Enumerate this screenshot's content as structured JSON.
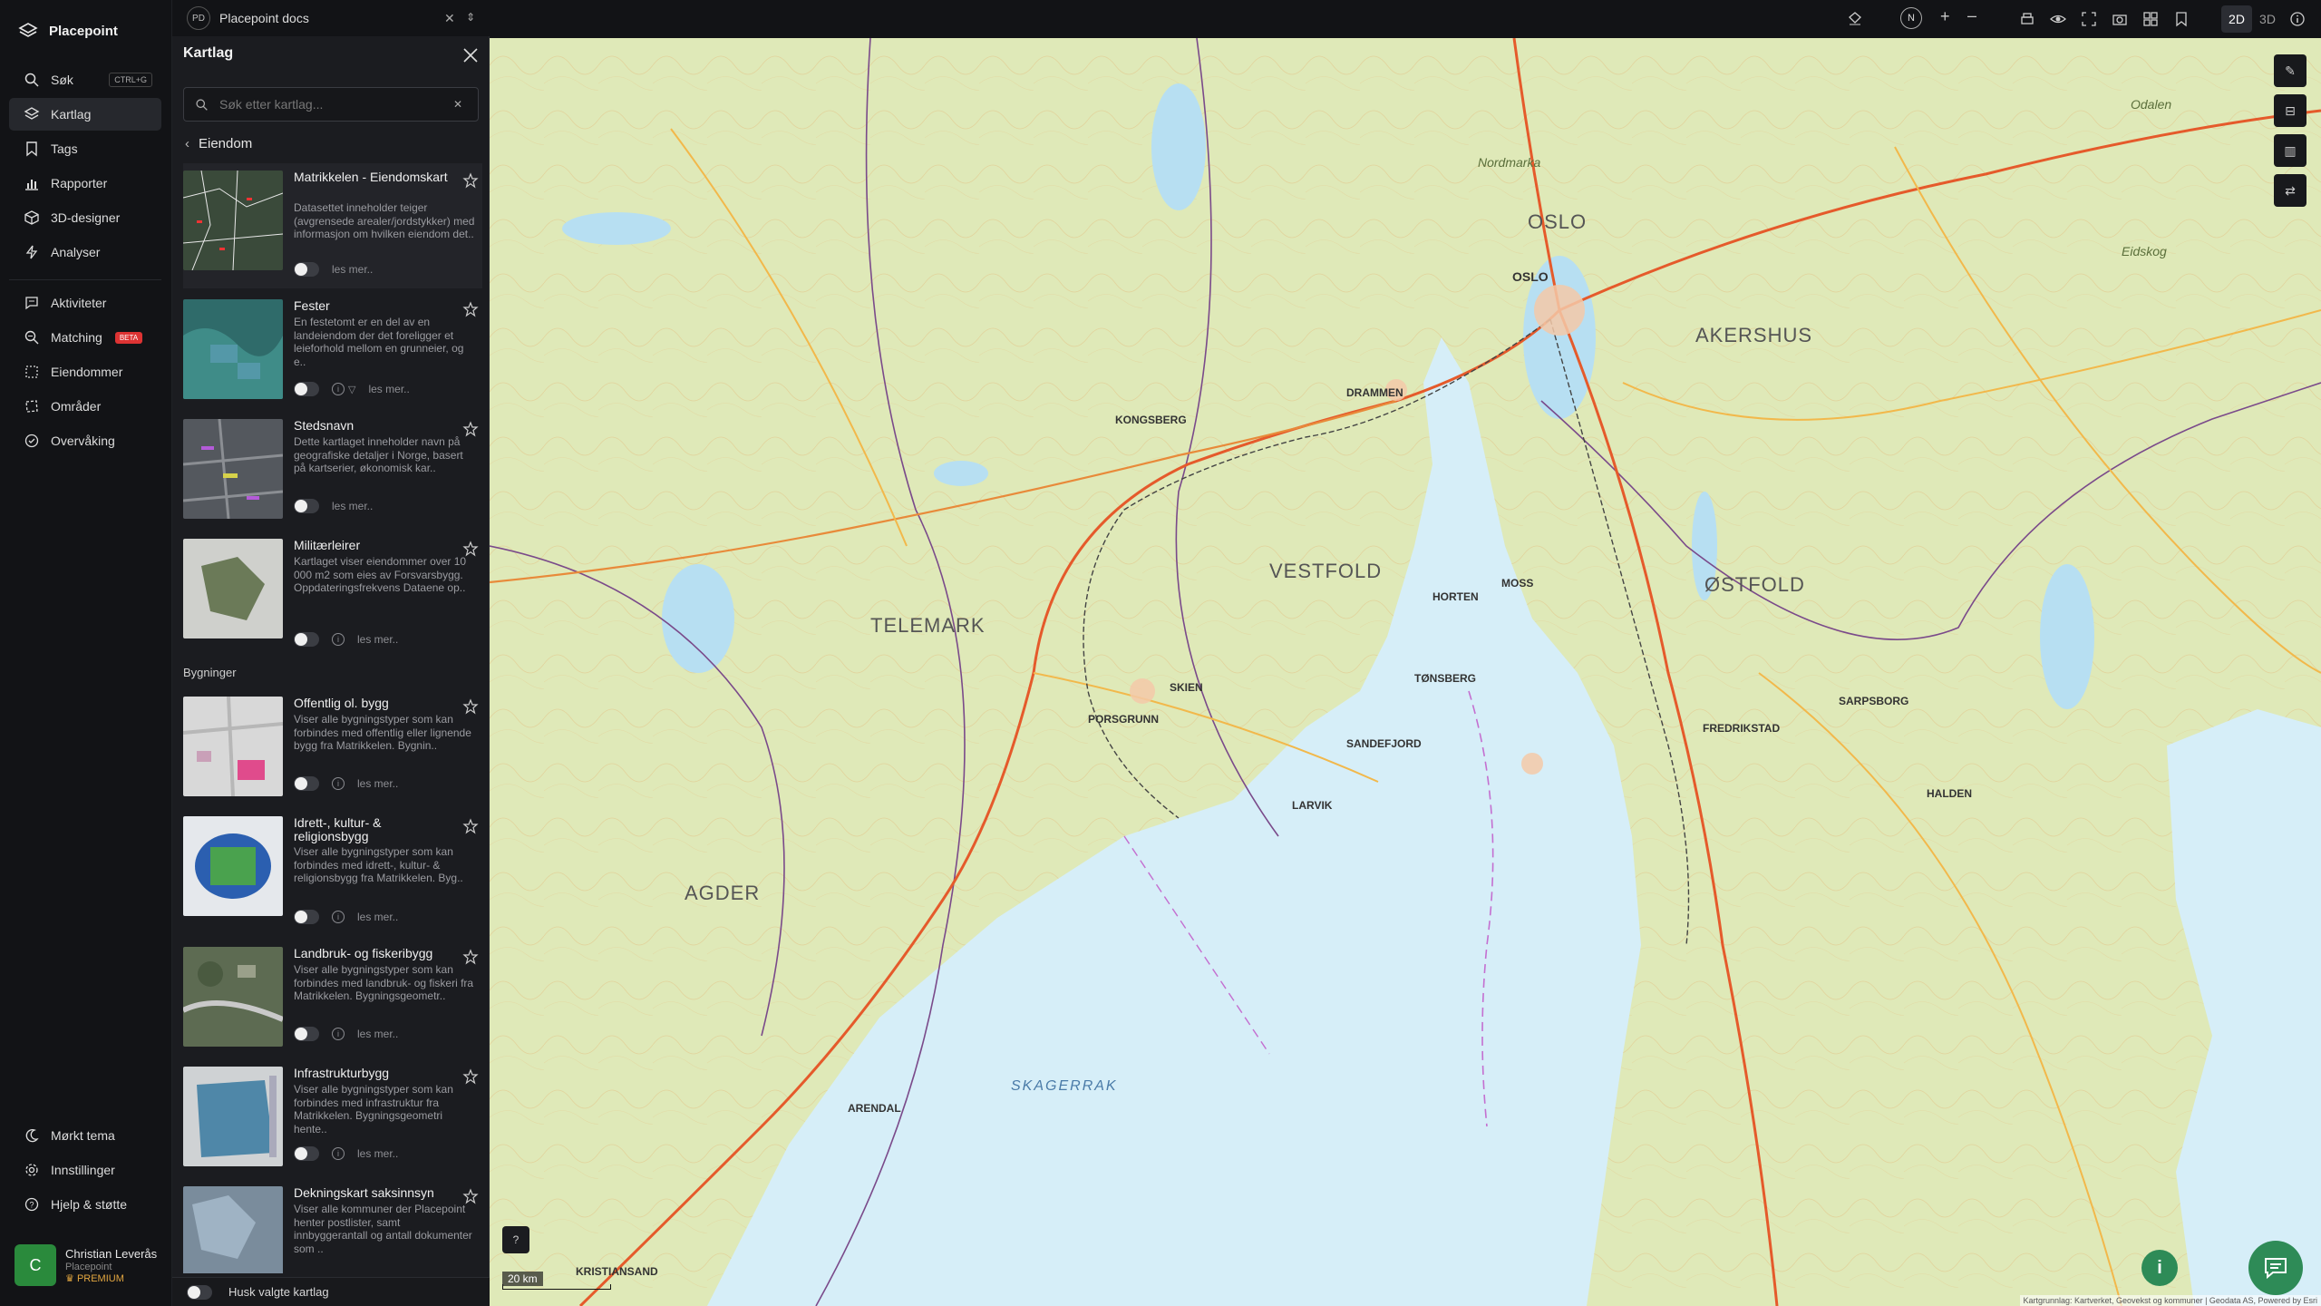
{
  "app": {
    "name": "Placepoint"
  },
  "nav": {
    "items": [
      {
        "label": "Søk",
        "shortcut": "CTRL+G",
        "icon": "search-icon"
      },
      {
        "label": "Kartlag",
        "icon": "layers-icon",
        "active": true
      },
      {
        "label": "Tags",
        "icon": "bookmark-icon"
      },
      {
        "label": "Rapporter",
        "icon": "bar-chart-icon"
      },
      {
        "label": "3D-designer",
        "icon": "cube-icon"
      },
      {
        "label": "Analyser",
        "icon": "bolt-icon"
      },
      {
        "label": "Aktiviteter",
        "icon": "chat-icon"
      },
      {
        "label": "Matching",
        "badge": "BETA",
        "icon": "search-magnify-icon"
      },
      {
        "label": "Eiendommer",
        "icon": "grid-icon"
      },
      {
        "label": "Områder",
        "icon": "area-icon"
      },
      {
        "label": "Overvåking",
        "icon": "check-circle-icon"
      }
    ],
    "bottom": [
      {
        "label": "Mørkt tema",
        "icon": "moon-icon"
      },
      {
        "label": "Innstillinger",
        "icon": "gear-icon"
      },
      {
        "label": "Hjelp & støtte",
        "icon": "help-icon"
      }
    ],
    "user": {
      "initial": "C",
      "name": "Christian Leverås",
      "org": "Placepoint",
      "plan": "PREMIUM"
    }
  },
  "workspace_tab": {
    "badge": "PD",
    "label": "Placepoint docs"
  },
  "panel": {
    "title": "Kartlag",
    "search_placeholder": "Søk etter kartlag...",
    "back_label": "Eiendom",
    "read_more": "les mer..",
    "section_buildings": "Bygninger",
    "footer_label": "Husk valgte kartlag",
    "layers": [
      {
        "title": "Matrikkelen - Eiendomskart",
        "desc": "Datasettet inneholder teiger (avgrensede arealer/jordstykker) med informasjon om hvilken eiendom det..",
        "info": false
      },
      {
        "title": "Fester",
        "desc": "En festetomt er en del av en landeiendom der det foreligger et leieforhold mellom en grunneier, og e..",
        "info": true
      },
      {
        "title": "Stedsnavn",
        "desc": "Dette kartlaget inneholder navn på geografiske detaljer i Norge, basert på kartserier, økonomisk kar..",
        "info": false
      },
      {
        "title": "Militærleirer",
        "desc": "Kartlaget viser eiendommer over 10 000 m2 som eies av Forsvarsbygg. Oppdateringsfrekvens Dataene op..",
        "info": true
      }
    ],
    "buildings": [
      {
        "title": "Offentlig ol. bygg",
        "desc": "Viser alle bygningstyper som kan forbindes med offentlig eller lignende bygg fra Matrikkelen. Bygnin..",
        "info": true
      },
      {
        "title": "Idrett-, kultur- & religionsbygg",
        "desc": "Viser alle bygningstyper som kan forbindes med idrett-, kultur- & religionsbygg fra Matrikkelen. Byg..",
        "info": true
      },
      {
        "title": "Landbruk- og fiskeribygg",
        "desc": "Viser alle bygningstyper som kan forbindes med landbruk- og fiskeri fra Matrikkelen. Bygningsgeometr..",
        "info": true
      },
      {
        "title": "Infrastrukturbygg",
        "desc": "Viser alle bygningstyper som kan forbindes med infrastruktur fra Matrikkelen. Bygningsgeometri hente..",
        "info": true
      },
      {
        "title": "Dekningskart saksinnsyn",
        "desc": "Viser alle kommuner der Placepoint henter postlister, samt innbyggerantall og antall dokumenter som ..",
        "info": false
      }
    ]
  },
  "topbar": {
    "compass": "N",
    "view_2d": "2D",
    "view_3d": "3D"
  },
  "map": {
    "labels": {
      "oslo_county": "OSLO",
      "oslo": "OSLO",
      "akershus": "AKERSHUS",
      "vestfold": "VESTFOLD",
      "telemark": "TELEMARK",
      "ostfold": "ØSTFOLD",
      "agder": "AGDER",
      "skagerrak": "SKAGERRAK",
      "drammen": "DRAMMEN",
      "kongsberg": "KONGSBERG",
      "tonsberg": "TØNSBERG",
      "sandefjord": "SANDEFJORD",
      "larvik": "LARVIK",
      "skien": "SKIEN",
      "porsgrunn": "PORSGRUNN",
      "arendal": "ARENDAL",
      "halden": "HALDEN",
      "sarpsborg": "SARPSBORG",
      "fredrikstad": "FREDRIKSTAD",
      "horten": "HORTEN",
      "moss": "MOSS",
      "kristiansand": "KRISTIANSAND",
      "nordmarka": "Nordmarka",
      "eidskog": "Eidskog",
      "odalen": "Odalen"
    },
    "scale_label": "20 km",
    "attribution": "Kartgrunnlag: Kartverket, Geovekst og kommuner | Geodata AS, Powered by Esri"
  }
}
